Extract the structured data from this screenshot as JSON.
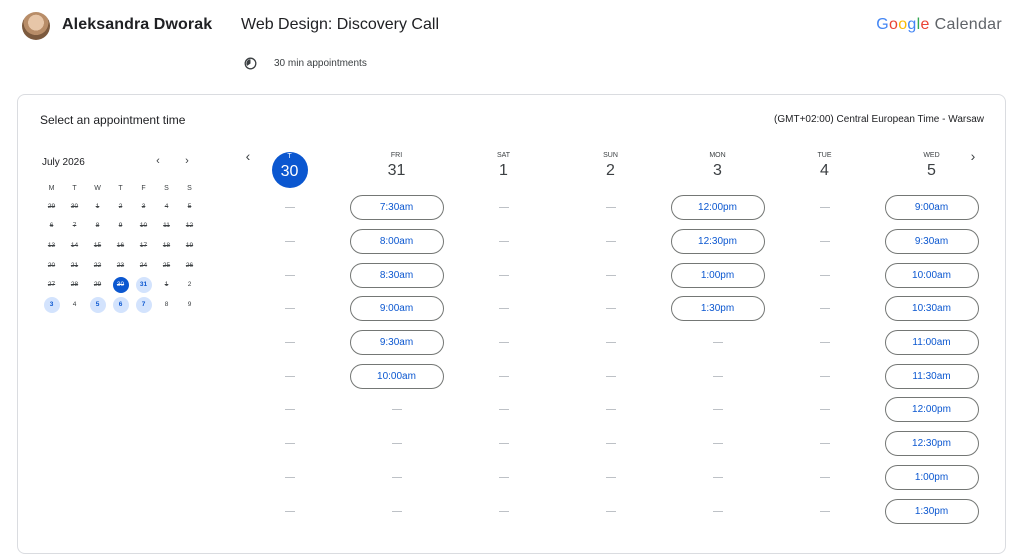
{
  "header": {
    "host_name": "Aleksandra Dworak",
    "event_title": "Web Design: Discovery Call",
    "duration": "30 min appointments",
    "logo_letters": [
      {
        "ch": "G",
        "color": "#4285F4"
      },
      {
        "ch": "o",
        "color": "#EA4335"
      },
      {
        "ch": "o",
        "color": "#FBBC05"
      },
      {
        "ch": "g",
        "color": "#4285F4"
      },
      {
        "ch": "l",
        "color": "#34A853"
      },
      {
        "ch": "e",
        "color": "#EA4335"
      }
    ],
    "logo_product": "Calendar"
  },
  "card": {
    "title": "Select an appointment time",
    "timezone": "(GMT+02:00) Central European Time - Warsaw"
  },
  "mini_calendar": {
    "month_label": "July 2026",
    "prev_icon": "chevron-left-icon",
    "next_icon": "chevron-right-icon",
    "weekdays": [
      "M",
      "T",
      "W",
      "T",
      "F",
      "S",
      "S"
    ],
    "days": [
      {
        "d": "29",
        "s": "past"
      },
      {
        "d": "30",
        "s": "past"
      },
      {
        "d": "1",
        "s": "past"
      },
      {
        "d": "2",
        "s": "past"
      },
      {
        "d": "3",
        "s": "past"
      },
      {
        "d": "4",
        "s": "past"
      },
      {
        "d": "5",
        "s": "past"
      },
      {
        "d": "6",
        "s": "past"
      },
      {
        "d": "7",
        "s": "past"
      },
      {
        "d": "8",
        "s": "past"
      },
      {
        "d": "9",
        "s": "past"
      },
      {
        "d": "10",
        "s": "past"
      },
      {
        "d": "11",
        "s": "past"
      },
      {
        "d": "12",
        "s": "past"
      },
      {
        "d": "13",
        "s": "past"
      },
      {
        "d": "14",
        "s": "past"
      },
      {
        "d": "15",
        "s": "past"
      },
      {
        "d": "16",
        "s": "past"
      },
      {
        "d": "17",
        "s": "past"
      },
      {
        "d": "18",
        "s": "past"
      },
      {
        "d": "19",
        "s": "past"
      },
      {
        "d": "20",
        "s": "past"
      },
      {
        "d": "21",
        "s": "past"
      },
      {
        "d": "22",
        "s": "past"
      },
      {
        "d": "23",
        "s": "past"
      },
      {
        "d": "24",
        "s": "past"
      },
      {
        "d": "25",
        "s": "past"
      },
      {
        "d": "26",
        "s": "past"
      },
      {
        "d": "27",
        "s": "past"
      },
      {
        "d": "28",
        "s": "past"
      },
      {
        "d": "29",
        "s": "past"
      },
      {
        "d": "30",
        "s": "selected"
      },
      {
        "d": "31",
        "s": "available"
      },
      {
        "d": "1",
        "s": "past"
      },
      {
        "d": "2",
        "s": "future"
      },
      {
        "d": "3",
        "s": "available"
      },
      {
        "d": "4",
        "s": "future"
      },
      {
        "d": "5",
        "s": "available"
      },
      {
        "d": "6",
        "s": "available"
      },
      {
        "d": "7",
        "s": "available"
      },
      {
        "d": "8",
        "s": "future"
      },
      {
        "d": "9",
        "s": "future"
      }
    ]
  },
  "week": {
    "prev_icon": "chevron-left-icon",
    "next_icon": "chevron-right-icon",
    "empty_rows": 10,
    "days": [
      {
        "dow": "T",
        "num": "30",
        "today": true,
        "slots": []
      },
      {
        "dow": "FRI",
        "num": "31",
        "today": false,
        "slots": [
          "7:30am",
          "8:00am",
          "8:30am",
          "9:00am",
          "9:30am",
          "10:00am"
        ]
      },
      {
        "dow": "SAT",
        "num": "1",
        "today": false,
        "slots": []
      },
      {
        "dow": "SUN",
        "num": "2",
        "today": false,
        "slots": []
      },
      {
        "dow": "MON",
        "num": "3",
        "today": false,
        "slots": [
          "12:00pm",
          "12:30pm",
          "1:00pm",
          "1:30pm"
        ]
      },
      {
        "dow": "TUE",
        "num": "4",
        "today": false,
        "slots": []
      },
      {
        "dow": "WED",
        "num": "5",
        "today": false,
        "slots": [
          "9:00am",
          "9:30am",
          "10:00am",
          "10:30am",
          "11:00am",
          "11:30am",
          "12:00pm",
          "12:30pm",
          "1:00pm",
          "1:30pm"
        ]
      }
    ]
  },
  "colors": {
    "accent": "#0b57d0",
    "available_day_bg": "#d3e3fd",
    "slot_border": "#747775"
  }
}
